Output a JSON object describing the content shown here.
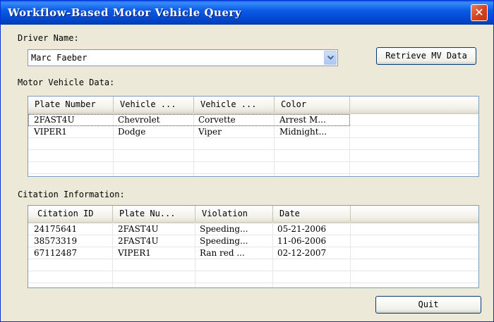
{
  "window": {
    "title": "Workflow-Based Motor Vehicle Query",
    "close_glyph": "✕"
  },
  "driver": {
    "label": "Driver Name:",
    "selected_value": "Marc Faeber"
  },
  "buttons": {
    "retrieve_label": "Retrieve MV Data",
    "quit_label": "Quit"
  },
  "vehicle_data": {
    "label": "Motor Vehicle Data:",
    "columns": [
      "Plate Number",
      "Vehicle ...",
      "Vehicle ...",
      "Color"
    ],
    "rows": [
      [
        "2FAST4U",
        "Chevrolet",
        "Corvette",
        "Arrest M..."
      ],
      [
        "VIPER1",
        "Dodge",
        "Viper",
        "Midnight..."
      ]
    ]
  },
  "citation_data": {
    "label": "Citation Information:",
    "columns": [
      "Citation ID",
      "Plate Nu...",
      "Violation",
      "Date"
    ],
    "rows": [
      [
        "24175641",
        "2FAST4U",
        "Speeding...",
        "05-21-2006"
      ],
      [
        "38573319",
        "2FAST4U",
        "Speeding...",
        "11-06-2006"
      ],
      [
        "67112487",
        "VIPER1",
        "Ran red ...",
        "02-12-2007"
      ]
    ]
  },
  "colors": {
    "titlebar": "#0a5ce8",
    "window_bg": "#ece9d8",
    "close_button": "#d2421e",
    "list_border": "#7f9db9"
  }
}
